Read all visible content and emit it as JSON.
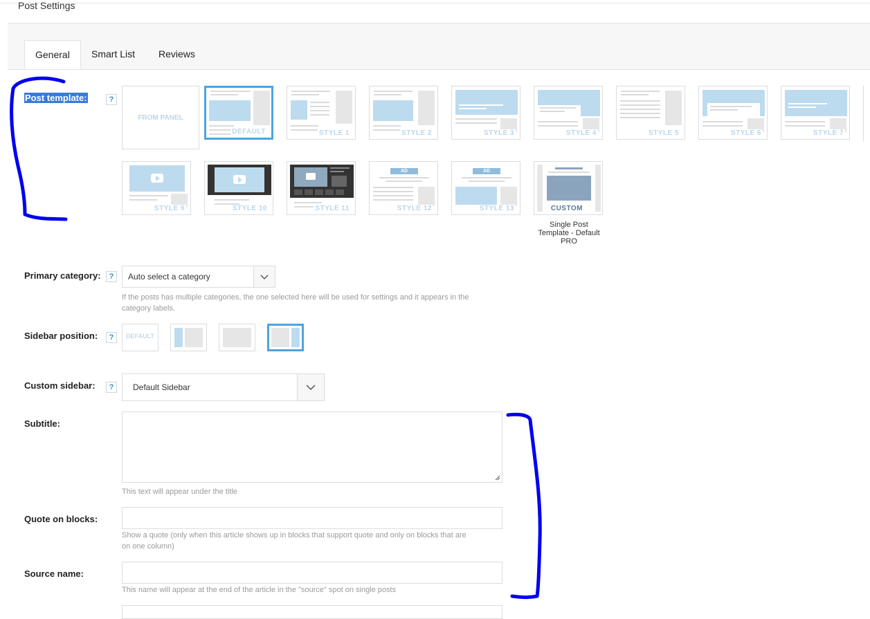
{
  "page": {
    "title": "Post Settings"
  },
  "tabs": [
    {
      "label": "General",
      "active": true
    },
    {
      "label": "Smart List",
      "active": false
    },
    {
      "label": "Reviews",
      "active": false
    }
  ],
  "help_glyph": "?",
  "post_template": {
    "label": "Post template:",
    "from_panel": "FROM PANEL",
    "items": [
      {
        "caption": "DEFAULT",
        "selected": true
      },
      {
        "caption": "STYLE 1"
      },
      {
        "caption": "STYLE 2"
      },
      {
        "caption": "STYLE 3"
      },
      {
        "caption": "STYLE 4"
      },
      {
        "caption": "STYLE 5"
      },
      {
        "caption": "STYLE 6"
      },
      {
        "caption": "STYLE 7"
      },
      {
        "caption": "STYLE 9"
      },
      {
        "caption": "STYLE 10"
      },
      {
        "caption": "STYLE 11"
      },
      {
        "caption": "STYLE 12"
      },
      {
        "caption": "STYLE 13"
      },
      {
        "caption": "CUSTOM"
      }
    ],
    "ad_text": "AD",
    "custom_note_1": "Single Post",
    "custom_note_2": "Template - Default",
    "custom_note_3": "PRO"
  },
  "primary_category": {
    "label": "Primary category:",
    "value": "Auto select a category",
    "hint_1": "If the posts has multiple categories, the one selected here will be used for settings and it appears in the",
    "hint_2": "category labels."
  },
  "sidebar_position": {
    "label": "Sidebar position:",
    "default_text": "DEFAULT",
    "selected": "right"
  },
  "custom_sidebar": {
    "label": "Custom sidebar:",
    "value": "Default Sidebar"
  },
  "subtitle": {
    "label": "Subtitle:",
    "value": "",
    "hint": "This text will appear under the title"
  },
  "quote": {
    "label": "Quote on blocks:",
    "value": "",
    "hint_1": "Show a quote (only when this article shows up in blocks that support quote and only on blocks that are",
    "hint_2": "on one column)"
  },
  "source": {
    "label": "Source name:",
    "value": "",
    "hint": "This name will appear at the end of the article in the \"source\" spot on single posts"
  },
  "colors": {
    "accent": "#4ea3dd",
    "annotation": "#0000ee",
    "help": "#3c8dc4"
  }
}
